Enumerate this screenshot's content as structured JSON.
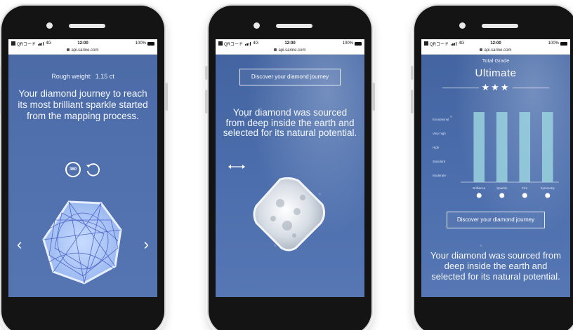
{
  "status_bar": {
    "carrier": "QRコード",
    "network": "4G",
    "time": "12:00",
    "battery": "100%"
  },
  "url_bar": {
    "url": "api.sarine.com"
  },
  "screen1": {
    "rough_weight_label": "Rough weight:",
    "rough_weight_value": "1.15 ct",
    "journey_text": "Your diamond journey to reach its most brilliant sparkle started from the mapping process.",
    "icon_360_label": "360",
    "prev_arrow": "‹",
    "next_arrow": "›"
  },
  "screen2": {
    "discover_button": "Discover your diamond journey",
    "sourced_text": "Your diamond was sourced from deep inside the earth and selected for its natural potential."
  },
  "screen3": {
    "grade_label": "Total Grade",
    "grade_value": "Ultimate",
    "stars": "★★★",
    "discover_button": "Discover your diamond journey",
    "sourced_text": "Your diamond was sourced from deep inside the earth and selected for its natural potential."
  },
  "chart_data": {
    "type": "bar",
    "levels": [
      "Exceptional",
      "Very high",
      "High",
      "Standard",
      "Moderate"
    ],
    "categories": [
      "Brilliance",
      "Sparkle",
      "Fire",
      "Symmetry"
    ],
    "values": [
      5,
      5,
      5,
      5
    ],
    "ylim": [
      0,
      5
    ],
    "bar_color": "#9ad2de"
  }
}
